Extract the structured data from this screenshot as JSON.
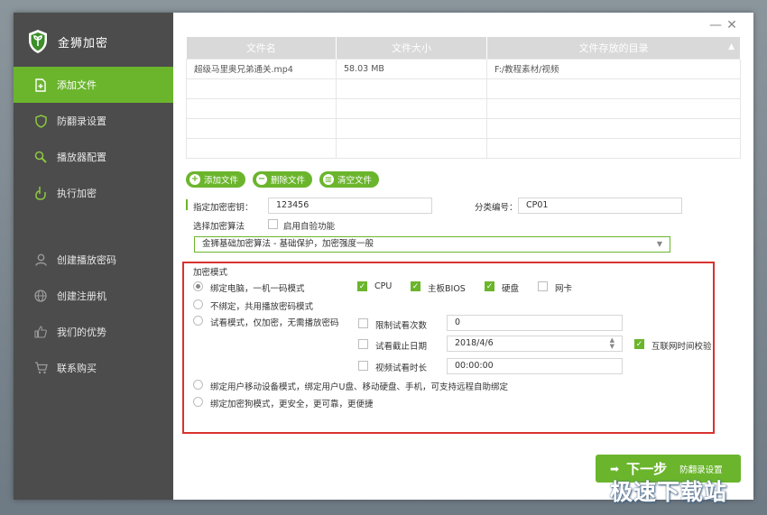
{
  "app": {
    "title": "金狮加密"
  },
  "window_controls": {
    "minimize": "—",
    "close": "✕"
  },
  "sidebar": {
    "items": [
      {
        "label": "添加文件",
        "icon": "add-file-icon",
        "active": true
      },
      {
        "label": "防翻录设置",
        "icon": "shield-icon",
        "active": false
      },
      {
        "label": "播放器配置",
        "icon": "search-icon",
        "active": false
      },
      {
        "label": "执行加密",
        "icon": "hand-icon",
        "active": false
      },
      {
        "label": "创建播放密码",
        "icon": "user-icon",
        "active": false
      },
      {
        "label": "创建注册机",
        "icon": "globe-icon",
        "active": false
      },
      {
        "label": "我们的优势",
        "icon": "thumb-up-icon",
        "active": false
      },
      {
        "label": "联系购买",
        "icon": "cart-icon",
        "active": false
      }
    ]
  },
  "file_table": {
    "headers": [
      "文件名",
      "文件大小",
      "文件存放的目录"
    ],
    "rows": [
      [
        "超级马里奥兄弟通关.mp4",
        "58.03 MB",
        "F:/教程素材/视频"
      ],
      [
        "",
        "",
        ""
      ],
      [
        "",
        "",
        ""
      ],
      [
        "",
        "",
        ""
      ],
      [
        "",
        "",
        ""
      ]
    ]
  },
  "file_buttons": {
    "add": "添加文件",
    "delete": "删除文件",
    "clear": "清空文件"
  },
  "settings": {
    "key_label": "指定加密密钥：",
    "key_value": "123456",
    "category_label": "分类编号：",
    "category_value": "CP01",
    "algorithm_label": "选择加密算法",
    "self_check_label": "启用自验功能",
    "self_check": false,
    "algorithm_value": "金狮基础加密算法 - 基础保护，加密强度一般"
  },
  "encrypt_mode": {
    "title": "加密模式",
    "bind_pc": {
      "label": "绑定电脑，一机一码模式",
      "selected": true
    },
    "hw": {
      "cpu": {
        "label": "CPU",
        "checked": true
      },
      "board": {
        "label": "主板BIOS",
        "checked": true
      },
      "disk": {
        "label": "硬盘",
        "checked": true
      },
      "nic": {
        "label": "网卡",
        "checked": false
      }
    },
    "no_bind": {
      "label": "不绑定，共用播放密码模式",
      "selected": false
    },
    "trial": {
      "label": "试看模式，仅加密，无需播放密码",
      "selected": false
    },
    "limit_count": {
      "label": "限制试看次数",
      "value": "0",
      "checked": false
    },
    "expire_date": {
      "label": "试看截止日期",
      "value": "2018/4/6",
      "checked": false
    },
    "trial_duration": {
      "label": "视频试看时长",
      "value": "00:00:00",
      "checked": false
    },
    "net_time": {
      "label": "互联网时间校验",
      "checked": true
    },
    "bind_mobile": {
      "label": "绑定用户移动设备模式，绑定用户U盘、移动硬盘、手机，可支持远程自助绑定",
      "selected": false
    },
    "bind_dongle": {
      "label": "绑定加密狗模式，更安全，更可靠，更便捷",
      "selected": false
    }
  },
  "next": {
    "arrow": "➡",
    "label": "下一步",
    "sub": "防翻录设置"
  },
  "watermark": "极速下载站",
  "colors": {
    "accent": "#6bb52d",
    "sidebar": "#4c4c4c",
    "highlight_box": "#d9322e"
  }
}
